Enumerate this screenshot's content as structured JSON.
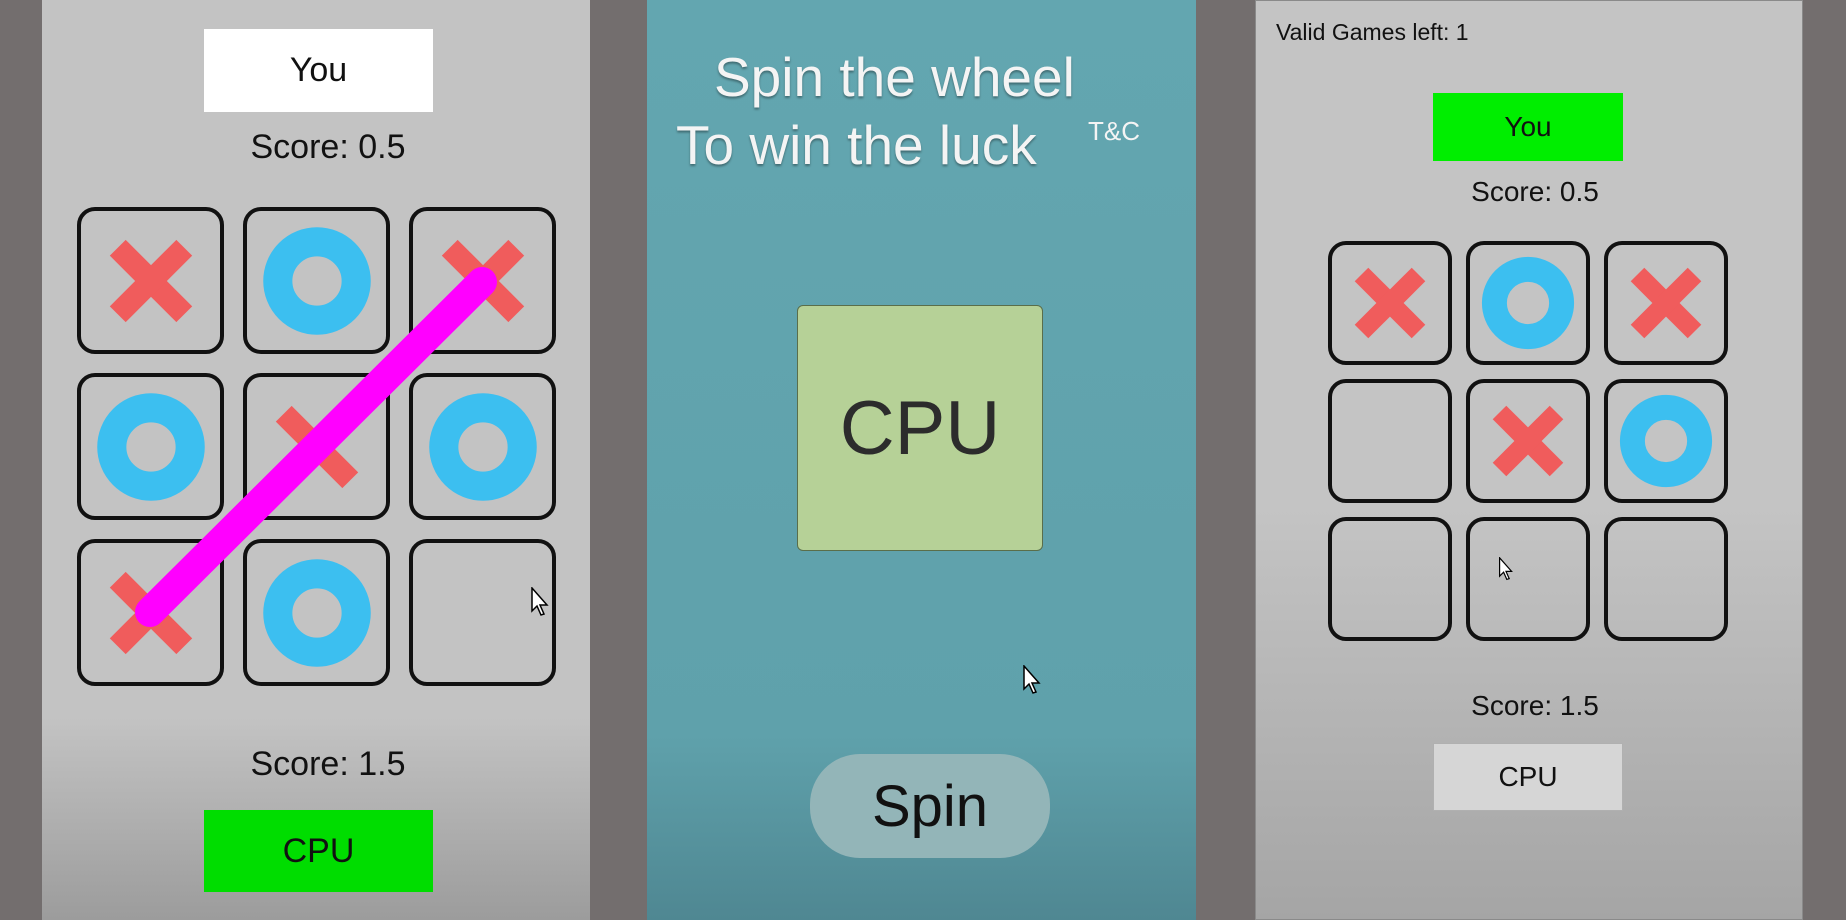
{
  "colors": {
    "x_mark": "#f05c5c",
    "o_mark": "#3cbff0",
    "win_line": "#ff00ff",
    "active_green": "#00dd00",
    "inactive_white": "#ffffff",
    "inactive_grey": "#d6d6d6",
    "wheel_box": "#b6d197"
  },
  "left_screen": {
    "player_label": "You",
    "player_score": "Score: 0.5",
    "board": [
      "X",
      "O",
      "X",
      "O",
      "X",
      "O",
      "X",
      "O",
      ""
    ],
    "win_line": "diagonal cells 2-4-6",
    "cpu_score": "Score: 1.5",
    "cpu_label": "CPU"
  },
  "middle_screen": {
    "title_line1": "Spin the wheel",
    "title_line2": "To win the luck",
    "terms_link": "T&C",
    "wheel_value": "CPU",
    "spin_label": "Spin"
  },
  "right_screen": {
    "games_left": "Valid Games left: 1",
    "player_label": "You",
    "player_score": "Score: 0.5",
    "board": [
      "X",
      "O",
      "X",
      "",
      "X",
      "O",
      "",
      "",
      ""
    ],
    "cpu_score": "Score: 1.5",
    "cpu_label": "CPU"
  }
}
